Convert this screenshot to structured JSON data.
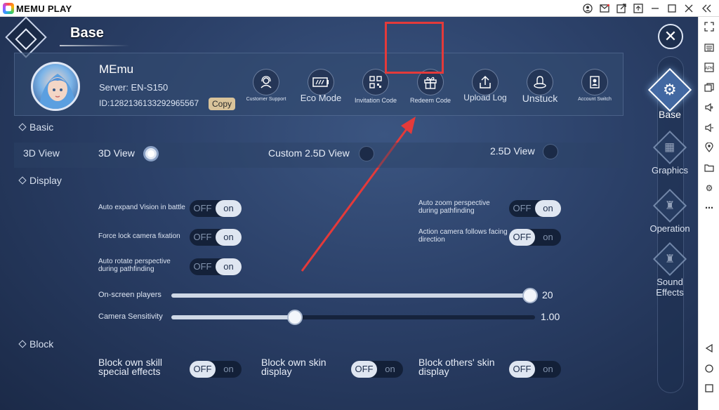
{
  "window": {
    "app_title": "MEMU PLAY",
    "titlebar_icons": [
      "account-icon",
      "mail-icon",
      "share-icon",
      "window-sync-icon",
      "minimize-icon",
      "maximize-icon",
      "close-icon",
      "collapse-icon"
    ]
  },
  "sidebar": {
    "icons": [
      "fullscreen-icon",
      "keyboard-icon",
      "apk-icon",
      "multi-window-icon",
      "volume-up-icon",
      "volume-down-icon",
      "location-icon",
      "folder-icon",
      "settings-icon",
      "more-icon",
      "back-icon",
      "home-icon",
      "recent-apps-icon"
    ]
  },
  "header": {
    "title": "Base"
  },
  "profile": {
    "name": "MEmu",
    "server": "Server: EN-S150",
    "id": "ID:1282136133292965567",
    "copy_label": "Copy"
  },
  "actions": [
    {
      "label": "Customer Support",
      "icon": "headset-icon"
    },
    {
      "label": "Eco Mode",
      "icon": "battery-icon"
    },
    {
      "label": "Invitation Code",
      "icon": "qr-code-icon"
    },
    {
      "label": "Redeem Code",
      "icon": "gift-icon"
    },
    {
      "label": "Upload Log",
      "icon": "upload-icon"
    },
    {
      "label": "Unstuck",
      "icon": "unstuck-icon"
    },
    {
      "label": "Account Switch",
      "icon": "account-switch-icon"
    }
  ],
  "right_menu": {
    "items": [
      {
        "label": "Base",
        "icon": "gear-icon",
        "active": true
      },
      {
        "label": "Graphics",
        "icon": "graphics-icon",
        "active": false
      },
      {
        "label": "Operation",
        "icon": "operation-icon",
        "active": false
      },
      {
        "label": "Sound Effects",
        "icon": "sound-icon",
        "active": false
      }
    ]
  },
  "sections": {
    "basic": "Basic",
    "display": "Display",
    "block": "Block"
  },
  "view": {
    "row_label": "3D View",
    "options": [
      {
        "label": "3D View",
        "checked": true
      },
      {
        "label": "Custom 2.5D View",
        "checked": false
      },
      {
        "label": "2.5D View",
        "checked": false
      }
    ]
  },
  "toggle_text": {
    "off": "OFF",
    "on": "on"
  },
  "display_options": [
    {
      "label": "Auto expand Vision in battle",
      "state": "on"
    },
    {
      "label": "Auto zoom perspective during pathfinding",
      "state": "on"
    },
    {
      "label": "Force lock camera fixation",
      "state": "on"
    },
    {
      "label": "Action camera follows facing direction",
      "state": "off"
    },
    {
      "label": "Auto rotate perspective during pathfinding",
      "state": "on"
    }
  ],
  "sliders": [
    {
      "label": "On-screen players",
      "value": "20",
      "fraction": 1.0
    },
    {
      "label": "Camera Sensitivity",
      "value": "1.00",
      "fraction": 0.34
    }
  ],
  "block_options": [
    {
      "label": "Block own skill special effects",
      "state": "off"
    },
    {
      "label": "Block own skin display",
      "state": "off"
    },
    {
      "label": "Block others' skin display",
      "state": "off"
    }
  ]
}
